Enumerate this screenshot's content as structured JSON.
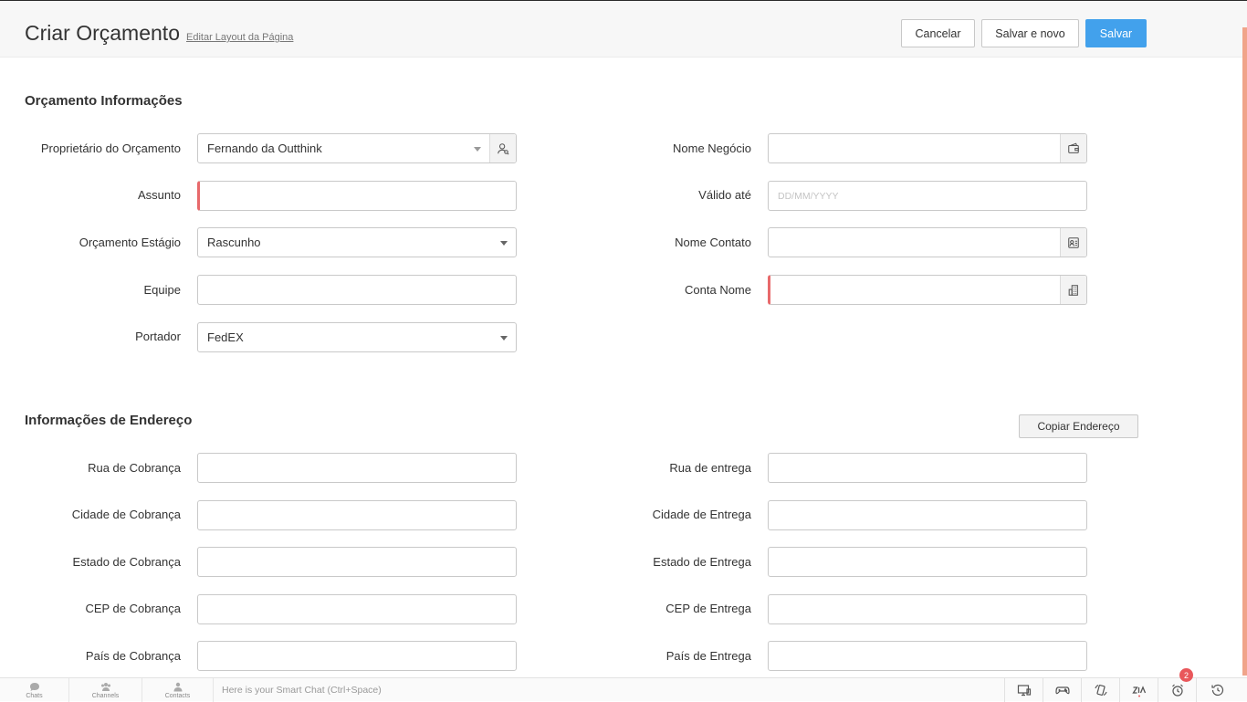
{
  "header": {
    "title": "Criar Orçamento",
    "edit_layout": "Editar Layout da Página",
    "cancel_label": "Cancelar",
    "save_new_label": "Salvar e novo",
    "save_label": "Salvar"
  },
  "quote_info": {
    "section_title": "Orçamento Informações",
    "owner_label": "Proprietário do Orçamento",
    "owner_value": "Fernando da Outthink",
    "subject_label": "Assunto",
    "subject_value": "",
    "stage_label": "Orçamento Estágio",
    "stage_value": "Rascunho",
    "team_label": "Equipe",
    "team_value": "",
    "carrier_label": "Portador",
    "carrier_value": "FedEX",
    "deal_label": "Nome Negócio",
    "deal_value": "",
    "valid_label": "Válido até",
    "valid_placeholder": "DD/MM/YYYY",
    "contact_label": "Nome Contato",
    "contact_value": "",
    "account_label": "Conta Nome",
    "account_value": ""
  },
  "address_info": {
    "section_title": "Informações de Endereço",
    "copy_button": "Copiar Endereço",
    "billing_street": "Rua de Cobrança",
    "billing_city": "Cidade de Cobrança",
    "billing_state": "Estado de Cobrança",
    "billing_zip": "CEP de Cobrança",
    "billing_country": "País de Cobrança",
    "shipping_street": "Rua de entrega",
    "shipping_city": "Cidade de Entrega",
    "shipping_state": "Estado de Entrega",
    "shipping_zip": "CEP de Entrega",
    "shipping_country": "País de Entrega"
  },
  "bottom_bar": {
    "chats": "Chats",
    "channels": "Channels",
    "contacts": "Contacts",
    "smart_chat_placeholder": "Here is your Smart Chat (Ctrl+Space)",
    "notification_count": "2"
  },
  "colors": {
    "primary": "#42a1ec",
    "required": "#e8696b",
    "badge": "#e9575b"
  }
}
